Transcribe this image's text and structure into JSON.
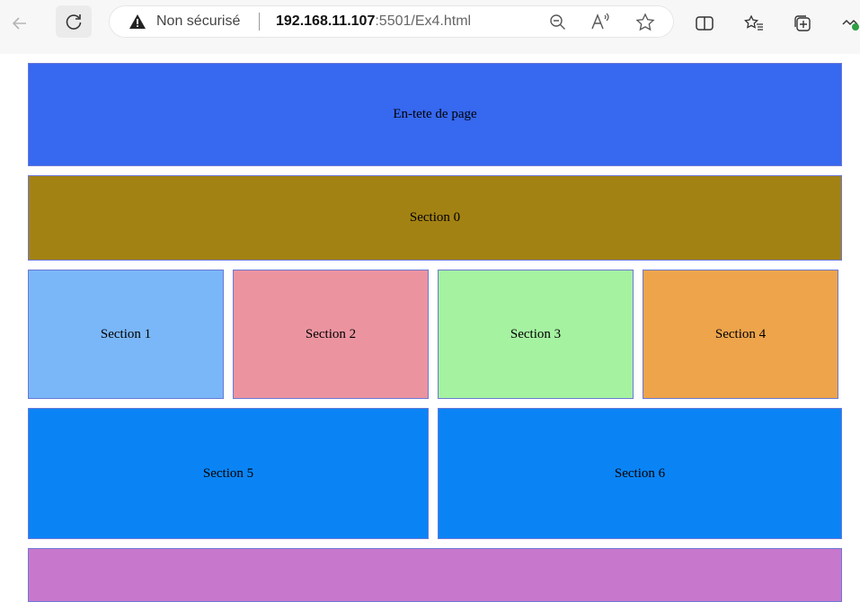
{
  "browser": {
    "security_label": "Non sécurisé",
    "url_host": "192.168.11.107",
    "url_path": ":5501/Ex4.html",
    "icons": [
      "back-icon",
      "refresh-icon",
      "warning-icon",
      "zoom-out-icon",
      "read-aloud-icon",
      "favorite-star-icon",
      "split-screen-icon",
      "favorites-icon",
      "collections-icon",
      "extension-icon"
    ]
  },
  "page": {
    "header": {
      "label": "En-tete de page",
      "color": "#3668f0"
    },
    "sections": [
      {
        "label": "Section 0",
        "color": "#a38214"
      },
      {
        "label": "Section 1",
        "color": "#7ab7f8"
      },
      {
        "label": "Section 2",
        "color": "#eb94a0"
      },
      {
        "label": "Section 3",
        "color": "#a5f2a1"
      },
      {
        "label": "Section 4",
        "color": "#eda44b"
      },
      {
        "label": "Section 5",
        "color": "#0a84f5"
      },
      {
        "label": "Section 6",
        "color": "#0a84f5"
      }
    ],
    "footer": {
      "label": "",
      "color": "#c878cc"
    },
    "border_color": "#6b79d6"
  }
}
